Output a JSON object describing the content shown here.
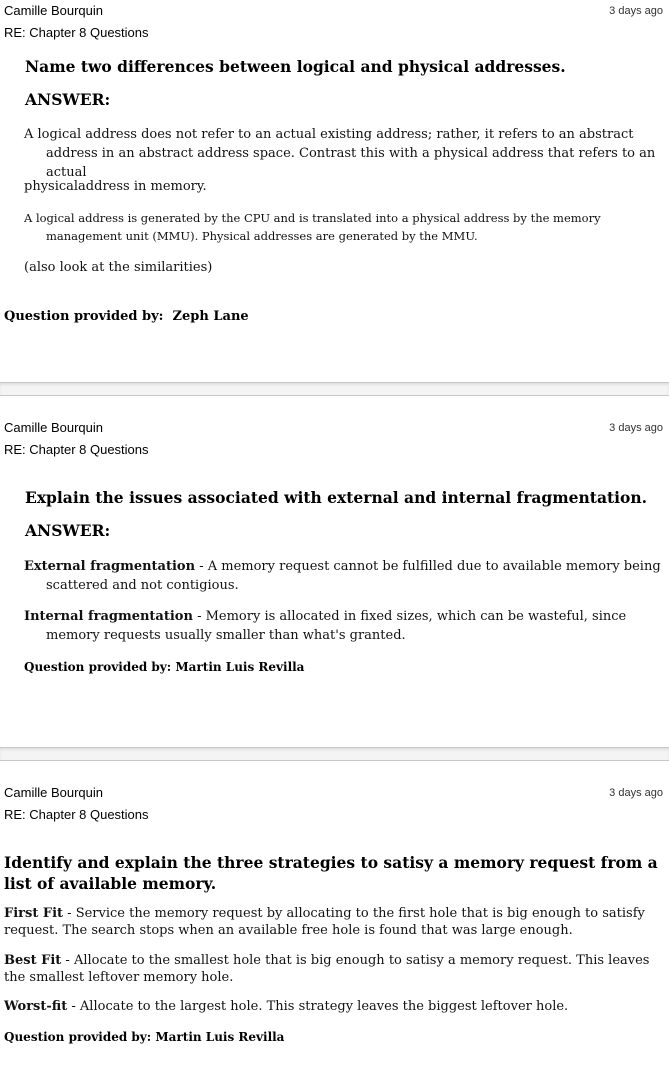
{
  "posts": [
    {
      "author": "Camille Bourquin",
      "time": "3 days ago",
      "subject": "RE: Chapter 8 Questions",
      "question": "Name two differences between logical and physical addresses.",
      "answer_label": "ANSWER:",
      "para1": "A logical address does not refer to an actual existing address; rather, it refers to an abstract address in an abstract address space. Contrast this with a physical address that refers to an actual",
      "para2": "physicaladdress in memory.",
      "para3": "A logical address is generated by the CPU and is translated into a physical address by the memory management unit (MMU). Physical addresses are generated by the MMU.",
      "para4": "(also look at the similarities)",
      "credit_label": "Question provided by:",
      "credit_name": "Zeph Lane"
    },
    {
      "author": "Camille Bourquin",
      "time": "3 days ago",
      "subject": "RE: Chapter 8 Questions",
      "question": "Explain the issues associated with external and internal fragmentation.",
      "answer_label": "ANSWER:",
      "ext_term": "External fragmentation",
      "ext_text": " - A memory request cannot be fulfilled due to available memory being scattered and not contigious.",
      "int_term": "Internal fragmentation",
      "int_text": " - Memory is allocated in fixed sizes, which can be wasteful, since memory requests usually smaller than what's granted.",
      "credit": "Question provided by: Martin Luis Revilla"
    },
    {
      "author": "Camille Bourquin",
      "time": "3 days ago",
      "subject": "RE: Chapter 8 Questions",
      "question": "Identify and explain the three strategies to satisy a memory request from a list of available memory.",
      "first_term": "First Fit",
      "first_text": " - Service the memory request by allocating to the first hole that is big enough to satisfy request. The search stops when an available free hole is found that was large enough.",
      "best_term": "Best Fit",
      "best_text": " - Allocate to the smallest hole that is big enough to satisy a memory request. This leaves the smallest leftover memory hole.",
      "worst_term": "Worst-fit",
      "worst_text": " - Allocate to the largest hole. This strategy leaves the biggest leftover hole.",
      "credit": "Question provided by: Martin Luis Revilla"
    }
  ]
}
